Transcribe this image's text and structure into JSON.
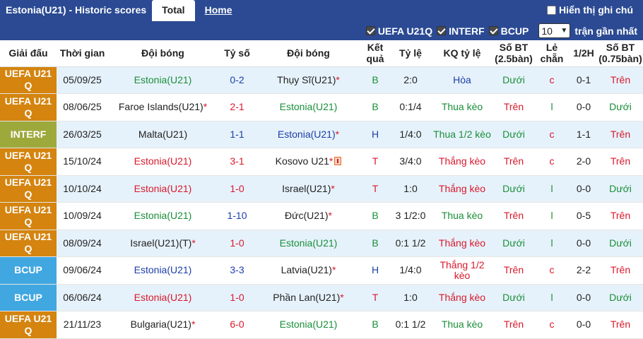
{
  "header": {
    "title": "Estonia(U21) - Historic scores",
    "tabs": [
      {
        "label": "Total"
      },
      {
        "label": "Home"
      }
    ],
    "show_notes_label": "Hiển thị ghi chú"
  },
  "filters": {
    "items": [
      {
        "label": "UEFA U21Q"
      },
      {
        "label": "INTERF"
      },
      {
        "label": "BCUP"
      }
    ],
    "count_value": "10",
    "count_suffix": "trận gần nhất"
  },
  "columns": {
    "league": "Giải đấu",
    "date": "Thời gian",
    "home": "Đội bóng",
    "score": "Tỷ số",
    "away": "Đội bóng",
    "result": "Kết quả",
    "odds": "Tỷ lệ",
    "odds_result": "KQ tỷ lệ",
    "ou": "Số BT (2.5bàn)",
    "oe": "Lẻ chẵn",
    "half": "1/2H",
    "ou75": "Số BT (0.75bàn)"
  },
  "colors": {
    "UEFA U21Q": "#d4840f",
    "INTERF": "#9ea93c",
    "BCUP": "#41a7e0"
  },
  "rows": [
    {
      "league": "UEFA U21 Q",
      "date": "05/09/25",
      "home": "Estonia(U21)",
      "home_color": "green",
      "home_star": false,
      "score": "0-2",
      "score_color": "blue",
      "away": "Thụy Sĩ(U21)",
      "away_color": "black",
      "away_star": true,
      "away_flag": false,
      "result": "B",
      "result_color": "green",
      "odds": "2:0",
      "odds_result": "Hòa",
      "odds_result_color": "blue",
      "ou": "Dưới",
      "ou_color": "green",
      "oe": "c",
      "oe_color": "red",
      "half": "0-1",
      "ou75": "Trên",
      "ou75_color": "red"
    },
    {
      "league": "UEFA U21 Q",
      "date": "08/06/25",
      "home": "Faroe Islands(U21)",
      "home_color": "black",
      "home_star": true,
      "score": "2-1",
      "score_color": "red",
      "away": "Estonia(U21)",
      "away_color": "green",
      "away_star": false,
      "away_flag": false,
      "result": "B",
      "result_color": "green",
      "odds": "0:1/4",
      "odds_result": "Thua kèo",
      "odds_result_color": "green",
      "ou": "Trên",
      "ou_color": "red",
      "oe": "l",
      "oe_color": "green",
      "half": "0-0",
      "ou75": "Dưới",
      "ou75_color": "green"
    },
    {
      "league": "INTERF",
      "date": "26/03/25",
      "home": "Malta(U21)",
      "home_color": "black",
      "home_star": false,
      "score": "1-1",
      "score_color": "blue",
      "away": "Estonia(U21)",
      "away_color": "blue",
      "away_star": true,
      "away_flag": false,
      "result": "H",
      "result_color": "blue",
      "odds": "1/4:0",
      "odds_result": "Thua 1/2 kèo",
      "odds_result_color": "green",
      "ou": "Dưới",
      "ou_color": "green",
      "oe": "c",
      "oe_color": "red",
      "half": "1-1",
      "ou75": "Trên",
      "ou75_color": "red"
    },
    {
      "league": "UEFA U21 Q",
      "date": "15/10/24",
      "home": "Estonia(U21)",
      "home_color": "red",
      "home_star": false,
      "score": "3-1",
      "score_color": "red",
      "away": "Kosovo U21",
      "away_color": "black",
      "away_star": true,
      "away_flag": true,
      "result": "T",
      "result_color": "red",
      "odds": "3/4:0",
      "odds_result": "Thắng kèo",
      "odds_result_color": "red",
      "ou": "Trên",
      "ou_color": "red",
      "oe": "c",
      "oe_color": "red",
      "half": "2-0",
      "ou75": "Trên",
      "ou75_color": "red"
    },
    {
      "league": "UEFA U21 Q",
      "date": "10/10/24",
      "home": "Estonia(U21)",
      "home_color": "red",
      "home_star": false,
      "score": "1-0",
      "score_color": "red",
      "away": "Israel(U21)",
      "away_color": "black",
      "away_star": true,
      "away_flag": false,
      "result": "T",
      "result_color": "red",
      "odds": "1:0",
      "odds_result": "Thắng kèo",
      "odds_result_color": "red",
      "ou": "Dưới",
      "ou_color": "green",
      "oe": "l",
      "oe_color": "green",
      "half": "0-0",
      "ou75": "Dưới",
      "ou75_color": "green"
    },
    {
      "league": "UEFA U21 Q",
      "date": "10/09/24",
      "home": "Estonia(U21)",
      "home_color": "green",
      "home_star": false,
      "score": "1-10",
      "score_color": "blue",
      "away": "Đức(U21)",
      "away_color": "black",
      "away_star": true,
      "away_flag": false,
      "result": "B",
      "result_color": "green",
      "odds": "3 1/2:0",
      "odds_result": "Thua kèo",
      "odds_result_color": "green",
      "ou": "Trên",
      "ou_color": "red",
      "oe": "l",
      "oe_color": "green",
      "half": "0-5",
      "ou75": "Trên",
      "ou75_color": "red"
    },
    {
      "league": "UEFA U21 Q",
      "date": "08/09/24",
      "home": "Israel(U21)(T)",
      "home_color": "black",
      "home_star": true,
      "score": "1-0",
      "score_color": "red",
      "away": "Estonia(U21)",
      "away_color": "green",
      "away_star": false,
      "away_flag": false,
      "result": "B",
      "result_color": "green",
      "odds": "0:1 1/2",
      "odds_result": "Thắng kèo",
      "odds_result_color": "red",
      "ou": "Dưới",
      "ou_color": "green",
      "oe": "l",
      "oe_color": "green",
      "half": "0-0",
      "ou75": "Dưới",
      "ou75_color": "green"
    },
    {
      "league": "BCUP",
      "date": "09/06/24",
      "home": "Estonia(U21)",
      "home_color": "blue",
      "home_star": false,
      "score": "3-3",
      "score_color": "blue",
      "away": "Latvia(U21)",
      "away_color": "black",
      "away_star": true,
      "away_flag": false,
      "result": "H",
      "result_color": "blue",
      "odds": "1/4:0",
      "odds_result": "Thắng 1/2 kèo",
      "odds_result_color": "red",
      "ou": "Trên",
      "ou_color": "red",
      "oe": "c",
      "oe_color": "red",
      "half": "2-2",
      "ou75": "Trên",
      "ou75_color": "red"
    },
    {
      "league": "BCUP",
      "date": "06/06/24",
      "home": "Estonia(U21)",
      "home_color": "red",
      "home_star": false,
      "score": "1-0",
      "score_color": "red",
      "away": "Phần Lan(U21)",
      "away_color": "black",
      "away_star": true,
      "away_flag": false,
      "result": "T",
      "result_color": "red",
      "odds": "1:0",
      "odds_result": "Thắng kèo",
      "odds_result_color": "red",
      "ou": "Dưới",
      "ou_color": "green",
      "oe": "l",
      "oe_color": "green",
      "half": "0-0",
      "ou75": "Dưới",
      "ou75_color": "green"
    },
    {
      "league": "UEFA U21 Q",
      "date": "21/11/23",
      "home": "Bulgaria(U21)",
      "home_color": "black",
      "home_star": true,
      "score": "6-0",
      "score_color": "red",
      "away": "Estonia(U21)",
      "away_color": "green",
      "away_star": false,
      "away_flag": false,
      "result": "B",
      "result_color": "green",
      "odds": "0:1 1/2",
      "odds_result": "Thua kèo",
      "odds_result_color": "green",
      "ou": "Trên",
      "ou_color": "red",
      "oe": "c",
      "oe_color": "red",
      "half": "0-0",
      "ou75": "Trên",
      "ou75_color": "red"
    }
  ]
}
